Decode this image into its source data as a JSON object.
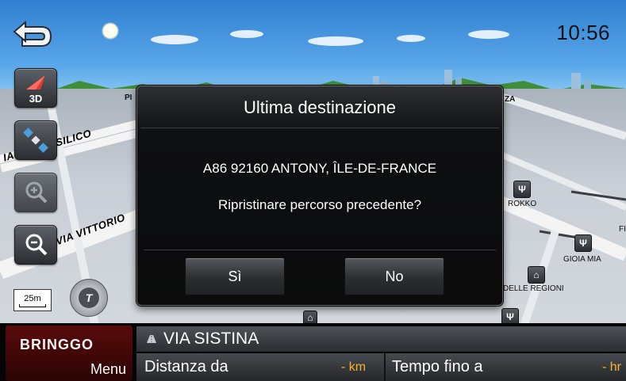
{
  "status": {
    "clock": "10:56"
  },
  "map": {
    "scale": "25m",
    "street_labels": [
      "IA DEL BASILICO",
      "VIA VITTORIO"
    ],
    "poi_labels": [
      "ROKKO",
      "GIOIA MIA",
      "DELLE REGIONI"
    ],
    "fragments": {
      "pi": "PI",
      "za": "ZA",
      "fi": "FI"
    },
    "view_mode": "3D"
  },
  "dialog": {
    "title": "Ultima destinazione",
    "address": "A86 92160 ANTONY, ÎLE-DE-FRANCE",
    "question": "Ripristinare percorso precedente?",
    "yes_label": "Sì",
    "no_label": "No"
  },
  "bottom": {
    "brand": "BRINGGO",
    "menu_label": "Menu",
    "street_name": "VIA SISTINA",
    "distance_label": "Distanza da",
    "distance_value": "- km",
    "time_label": "Tempo fino a",
    "time_value": "- hr"
  },
  "colors": {
    "accent": "#f5b52a",
    "brand_red": "#5a0b0b"
  },
  "icons": [
    "back-icon",
    "sun-icon",
    "3d-view-icon",
    "gps-satellite-icon",
    "zoom-in-icon",
    "zoom-out-icon",
    "compass-icon",
    "restaurant-icon",
    "building-icon",
    "road-icon"
  ]
}
